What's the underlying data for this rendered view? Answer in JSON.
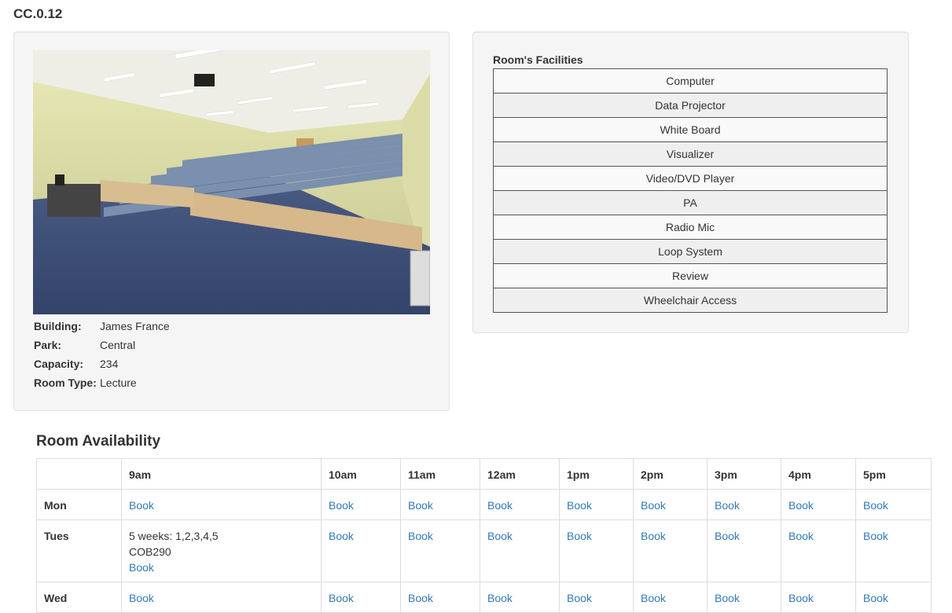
{
  "room": {
    "code": "CC.0.12",
    "details": [
      {
        "label": "Building:",
        "value": "James France"
      },
      {
        "label": "Park:",
        "value": "Central"
      },
      {
        "label": "Capacity:",
        "value": "234"
      },
      {
        "label": "Room Type:",
        "value": "Lecture"
      }
    ]
  },
  "facilities": {
    "heading": "Room's Facilities",
    "items": [
      "Computer",
      "Data Projector",
      "White Board",
      "Visualizer",
      "Video/DVD Player",
      "PA",
      "Radio Mic",
      "Loop System",
      "Review",
      "Wheelchair Access"
    ]
  },
  "availability": {
    "heading": "Room Availability",
    "times": [
      "9am",
      "10am",
      "11am",
      "12am",
      "1pm",
      "2pm",
      "3pm",
      "4pm",
      "5pm"
    ],
    "book_label": "Book",
    "rows": [
      {
        "day": "Mon",
        "cells": [
          {
            "book": "Book"
          },
          {
            "book": "Book"
          },
          {
            "book": "Book"
          },
          {
            "book": "Book"
          },
          {
            "book": "Book"
          },
          {
            "book": "Book"
          },
          {
            "book": "Book"
          },
          {
            "book": "Book"
          },
          {
            "book": "Book"
          }
        ]
      },
      {
        "day": "Tues",
        "cells": [
          {
            "lines": [
              "5 weeks: 1,2,3,4,5",
              "COB290"
            ],
            "book": "Book"
          },
          {
            "book": "Book"
          },
          {
            "book": "Book"
          },
          {
            "book": "Book"
          },
          {
            "book": "Book"
          },
          {
            "book": "Book"
          },
          {
            "book": "Book"
          },
          {
            "book": "Book"
          },
          {
            "book": "Book"
          }
        ]
      },
      {
        "day": "Wed",
        "cells": [
          {
            "book": "Book"
          },
          {
            "book": "Book"
          },
          {
            "book": "Book"
          },
          {
            "book": "Book"
          },
          {
            "book": "Book"
          },
          {
            "book": "Book"
          },
          {
            "book": "Book"
          },
          {
            "book": "Book"
          },
          {
            "book": "Book"
          }
        ]
      }
    ]
  },
  "colors": {
    "link": "#337ab7",
    "well_bg": "#f5f5f5"
  }
}
